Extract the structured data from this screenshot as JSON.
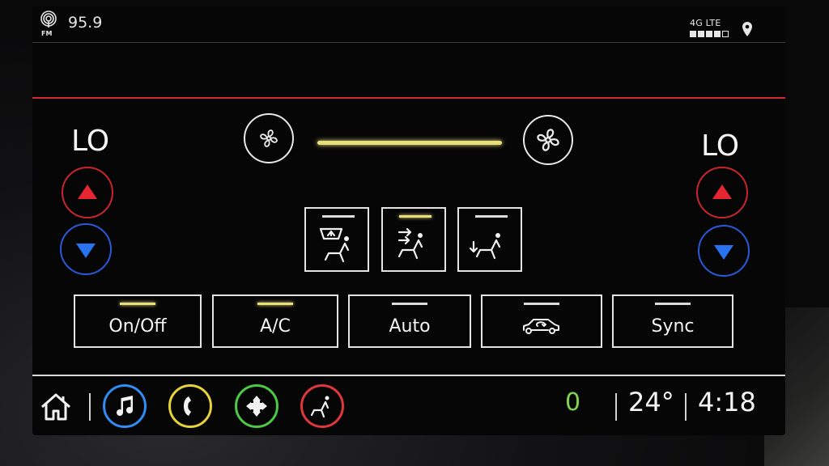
{
  "status_bar": {
    "radio_band_icon": "fm-radio-icon",
    "radio_band": "FM",
    "station": "95.9",
    "network": "4G LTE",
    "signal_bars": 4,
    "signal_total": 5,
    "location_icon": "location-pin-icon"
  },
  "climate": {
    "driver_temp": "LO",
    "passenger_temp": "LO",
    "fan_level": 1.0,
    "fan_down_icon": "fan-low-icon",
    "fan_up_icon": "fan-high-icon",
    "modes": [
      {
        "name": "defrost-mode",
        "icon": "defrost-seat-icon",
        "active": false
      },
      {
        "name": "face-mode",
        "icon": "face-vent-seat-icon",
        "active": true
      },
      {
        "name": "feet-mode",
        "icon": "feet-vent-seat-icon",
        "active": false
      }
    ],
    "functions": {
      "onoff_label": "On/Off",
      "ac_label": "A/C",
      "auto_label": "Auto",
      "recirc_icon": "recirculation-car-icon",
      "sync_label": "Sync"
    },
    "colors": {
      "active_indicator": "#e9df7a",
      "temp_up": "#e52630",
      "temp_down": "#2a73f0",
      "divider": "#d2282e"
    }
  },
  "nav": {
    "home_icon": "home-icon",
    "apps": [
      {
        "name": "audio",
        "icon": "music-note-icon",
        "color": "#2f8df5"
      },
      {
        "name": "phone",
        "icon": "phone-icon",
        "color": "#e6d23a"
      },
      {
        "name": "nav",
        "icon": "navigation-icon",
        "color": "#4cc845"
      },
      {
        "name": "climate",
        "icon": "climate-seat-icon",
        "color": "#e0373a"
      }
    ],
    "notification_count": "0",
    "outside_temp": "24°",
    "time": "4:18"
  }
}
